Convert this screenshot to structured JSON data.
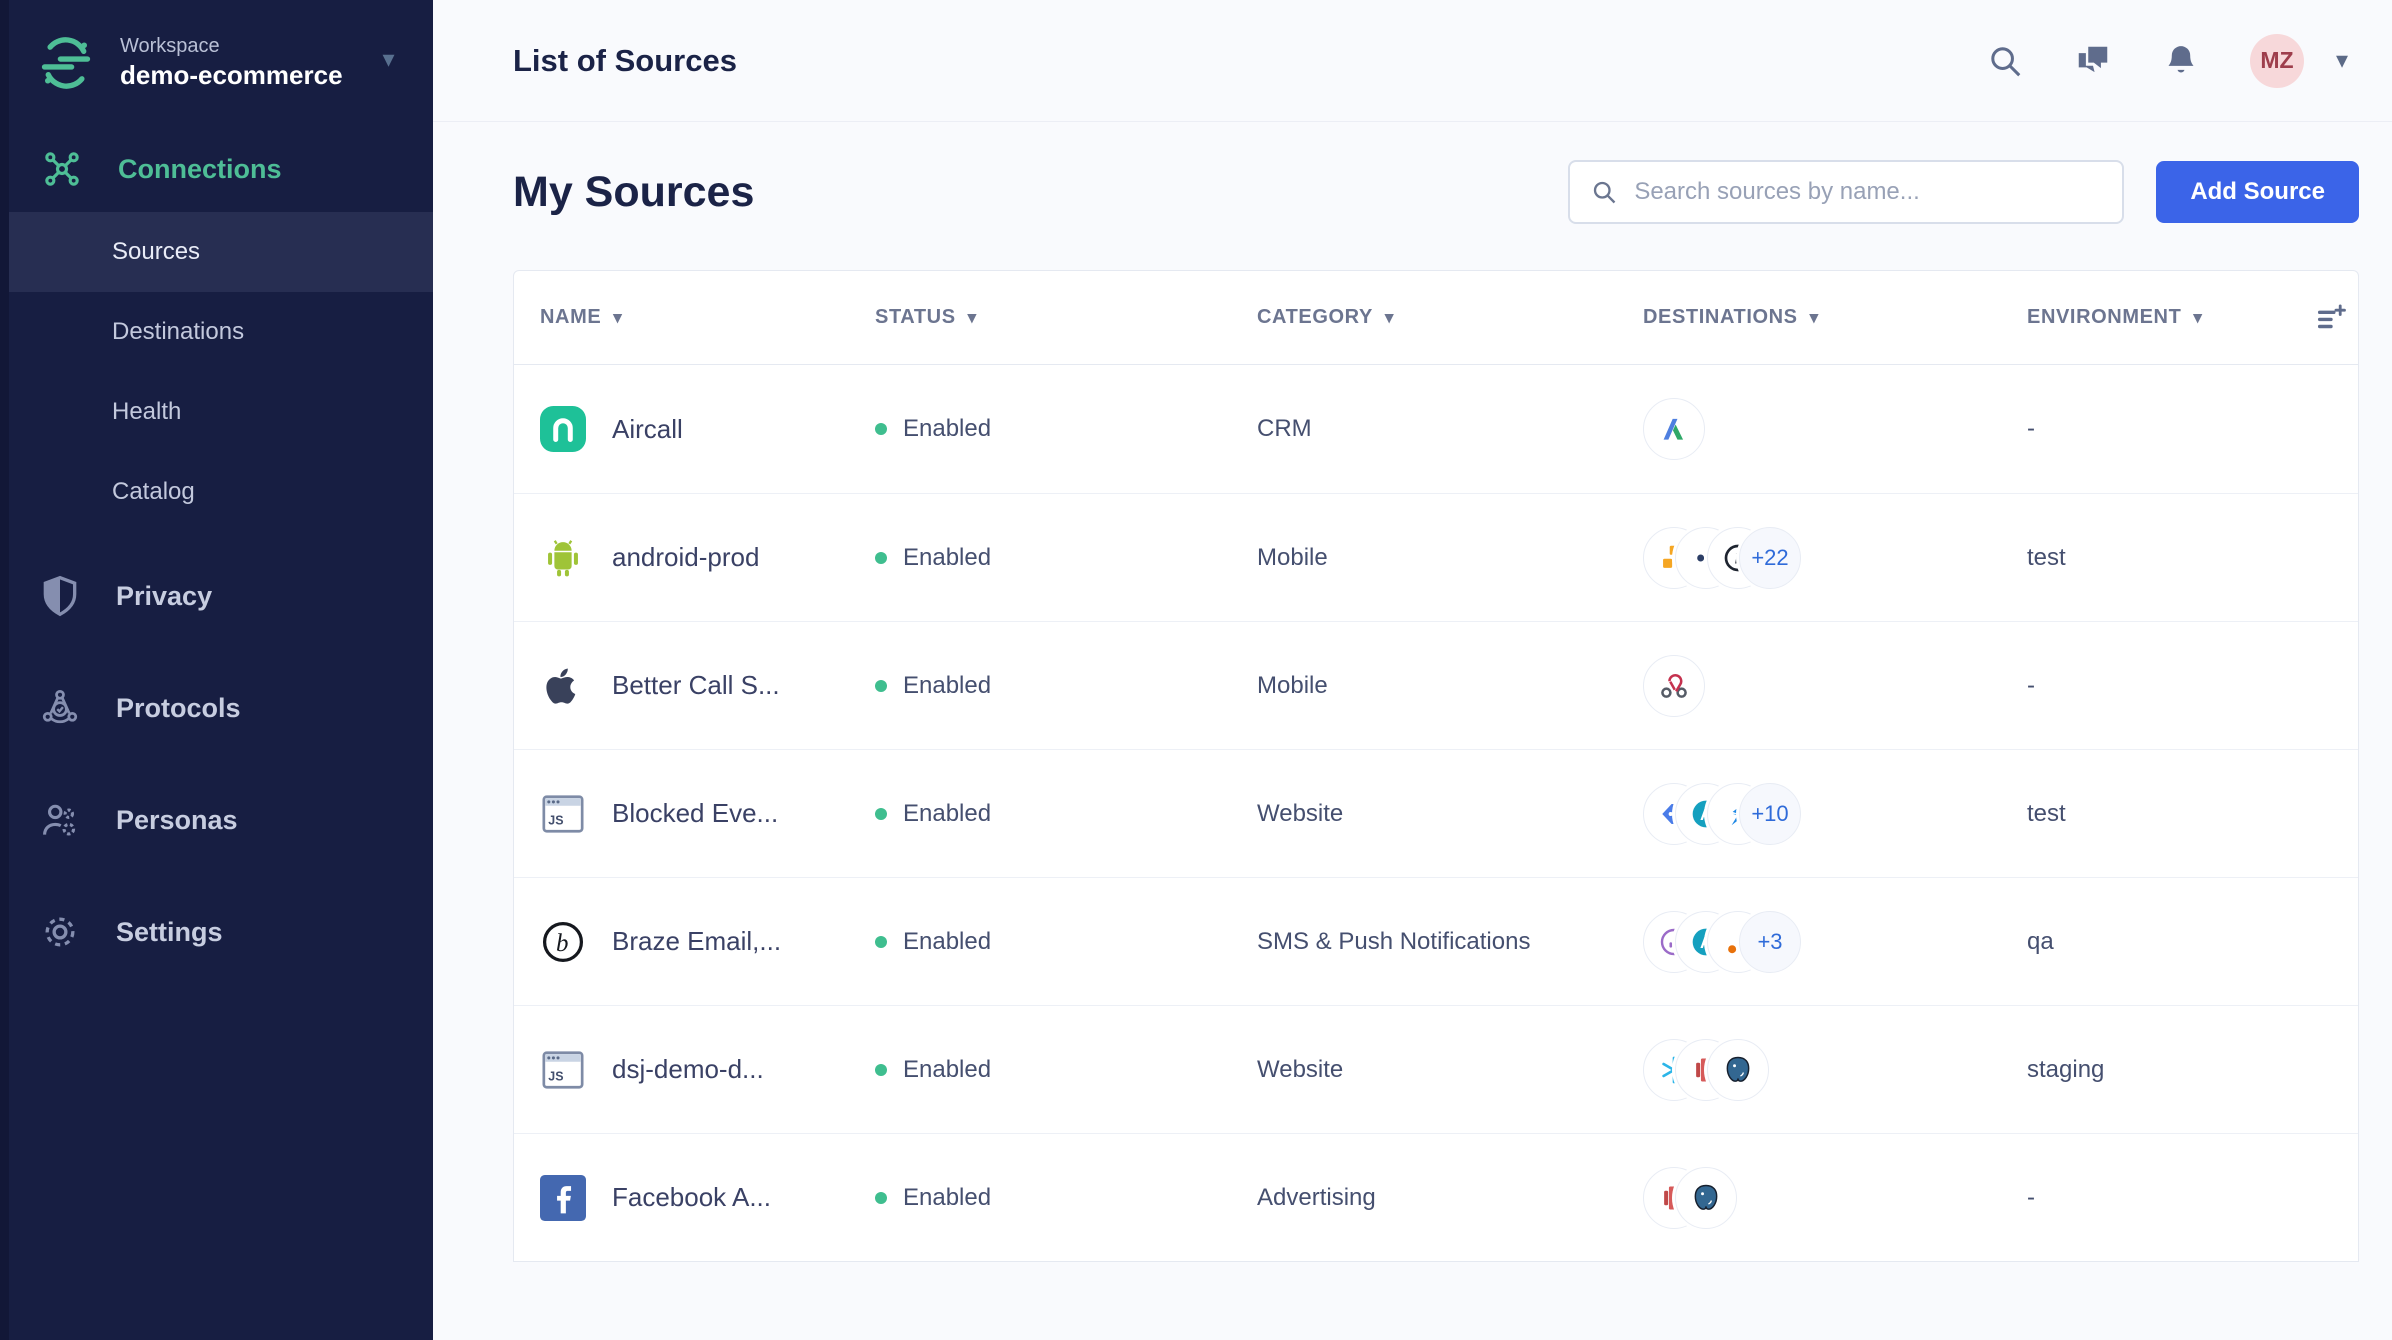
{
  "colors": {
    "sidebar_bg": "#171E42",
    "accent_green": "#4EBE96",
    "primary_blue": "#3B64E8",
    "status_green": "#3FBE8F",
    "avatar_bg": "#F7D8DA",
    "avatar_text": "#9E3E4C",
    "page_bg": "#F9FAFD",
    "text_dark": "#1B2347",
    "text_muted": "#6C7590"
  },
  "sidebar": {
    "workspace_label": "Workspace",
    "workspace_name": "demo-ecommerce",
    "primary_nav": {
      "label": "Connections",
      "icon": "connections-icon"
    },
    "sub_items": [
      {
        "label": "Sources",
        "active": true
      },
      {
        "label": "Destinations",
        "active": false
      },
      {
        "label": "Health",
        "active": false
      },
      {
        "label": "Catalog",
        "active": false
      }
    ],
    "sections": [
      {
        "label": "Privacy",
        "icon": "shield-icon"
      },
      {
        "label": "Protocols",
        "icon": "protocols-icon"
      },
      {
        "label": "Personas",
        "icon": "personas-icon"
      },
      {
        "label": "Settings",
        "icon": "gear-icon"
      }
    ]
  },
  "header": {
    "title": "List of Sources",
    "avatar_initials": "MZ"
  },
  "main": {
    "heading": "My Sources",
    "search_placeholder": "Search sources by name...",
    "add_button_label": "Add Source"
  },
  "table": {
    "columns": [
      "Name",
      "Status",
      "Category",
      "Destinations",
      "Environment"
    ],
    "rows": [
      {
        "name": "Aircall",
        "icon": "aircall",
        "status": "Enabled",
        "category": "CRM",
        "destinations": [
          "adwords"
        ],
        "more": "",
        "environment": "-"
      },
      {
        "name": "android-prod",
        "icon": "android",
        "status": "Enabled",
        "category": "Mobile",
        "destinations": [
          "aws",
          "dots",
          "ring"
        ],
        "more": "+22",
        "environment": "test"
      },
      {
        "name": "Better Call S...",
        "icon": "apple",
        "status": "Enabled",
        "category": "Mobile",
        "destinations": [
          "webhook"
        ],
        "more": "",
        "environment": "-"
      },
      {
        "name": "Blocked Eve...",
        "icon": "jsbox",
        "status": "Enabled",
        "category": "Website",
        "destinations": [
          "blueshield",
          "teal-a",
          "blue-s"
        ],
        "more": "+10",
        "environment": "test"
      },
      {
        "name": "Braze Email,...",
        "icon": "braze",
        "status": "Enabled",
        "category": "SMS & Push Notifications",
        "destinations": [
          "purple-ring",
          "teal-a",
          "ga"
        ],
        "more": "+3",
        "environment": "qa"
      },
      {
        "name": "dsj-demo-d...",
        "icon": "jsbox",
        "status": "Enabled",
        "category": "Website",
        "destinations": [
          "snowflake",
          "redshift",
          "postgres"
        ],
        "more": "",
        "environment": "staging"
      },
      {
        "name": "Facebook A...",
        "icon": "facebook",
        "status": "Enabled",
        "category": "Advertising",
        "destinations": [
          "redshift",
          "postgres"
        ],
        "more": "",
        "environment": "-"
      }
    ]
  }
}
